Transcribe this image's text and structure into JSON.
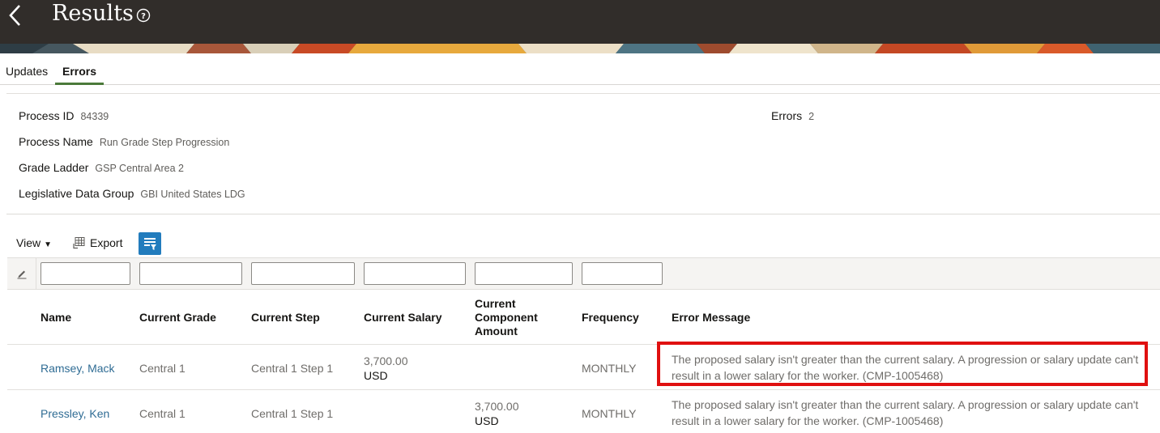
{
  "header": {
    "title": "Results"
  },
  "tabs": [
    {
      "label": "Updates"
    },
    {
      "label": "Errors"
    }
  ],
  "info": {
    "process_id": {
      "label": "Process ID",
      "value": "84339"
    },
    "process_name": {
      "label": "Process Name",
      "value": "Run Grade Step Progression"
    },
    "grade_ladder": {
      "label": "Grade Ladder",
      "value": "GSP Central Area 2"
    },
    "ldg": {
      "label": "Legislative Data Group",
      "value": "GBI United States LDG"
    },
    "errors": {
      "label": "Errors",
      "value": "2"
    }
  },
  "toolbar": {
    "view_label": "View",
    "view_caret": "▼",
    "export_label": "Export"
  },
  "table": {
    "columns": [
      {
        "label": "Name"
      },
      {
        "label": "Current Grade"
      },
      {
        "label": "Current Step"
      },
      {
        "label": "Current Salary"
      },
      {
        "label": "Current\nComponent\nAmount"
      },
      {
        "label": "Frequency"
      },
      {
        "label": "Error Message"
      }
    ],
    "rows": [
      {
        "name": "Ramsey, Mack",
        "grade": "Central 1",
        "step": "Central 1 Step 1",
        "salary": "3,700.00",
        "salary_currency": "USD",
        "component_amount": "",
        "component_currency": "",
        "frequency": "MONTHLY",
        "error_message": "The proposed salary isn't greater than the current salary. A progression or salary update can't result in a lower salary for the worker. (CMP-1005468)"
      },
      {
        "name": "Pressley, Ken",
        "grade": "Central 1",
        "step": "Central 1 Step 1",
        "salary": "",
        "salary_currency": "",
        "component_amount": "3,700.00",
        "component_currency": "USD",
        "frequency": "MONTHLY",
        "error_message": "The proposed salary isn't greater than the current salary. A progression or salary update can't result in a lower salary for the worker. (CMP-1005468)"
      }
    ]
  },
  "colors": {
    "header_bg": "#312d2a",
    "active_tab": "#4b7a3a",
    "link": "#2f6c94",
    "highlight": "#e01010",
    "accent_button": "#227cbd"
  }
}
